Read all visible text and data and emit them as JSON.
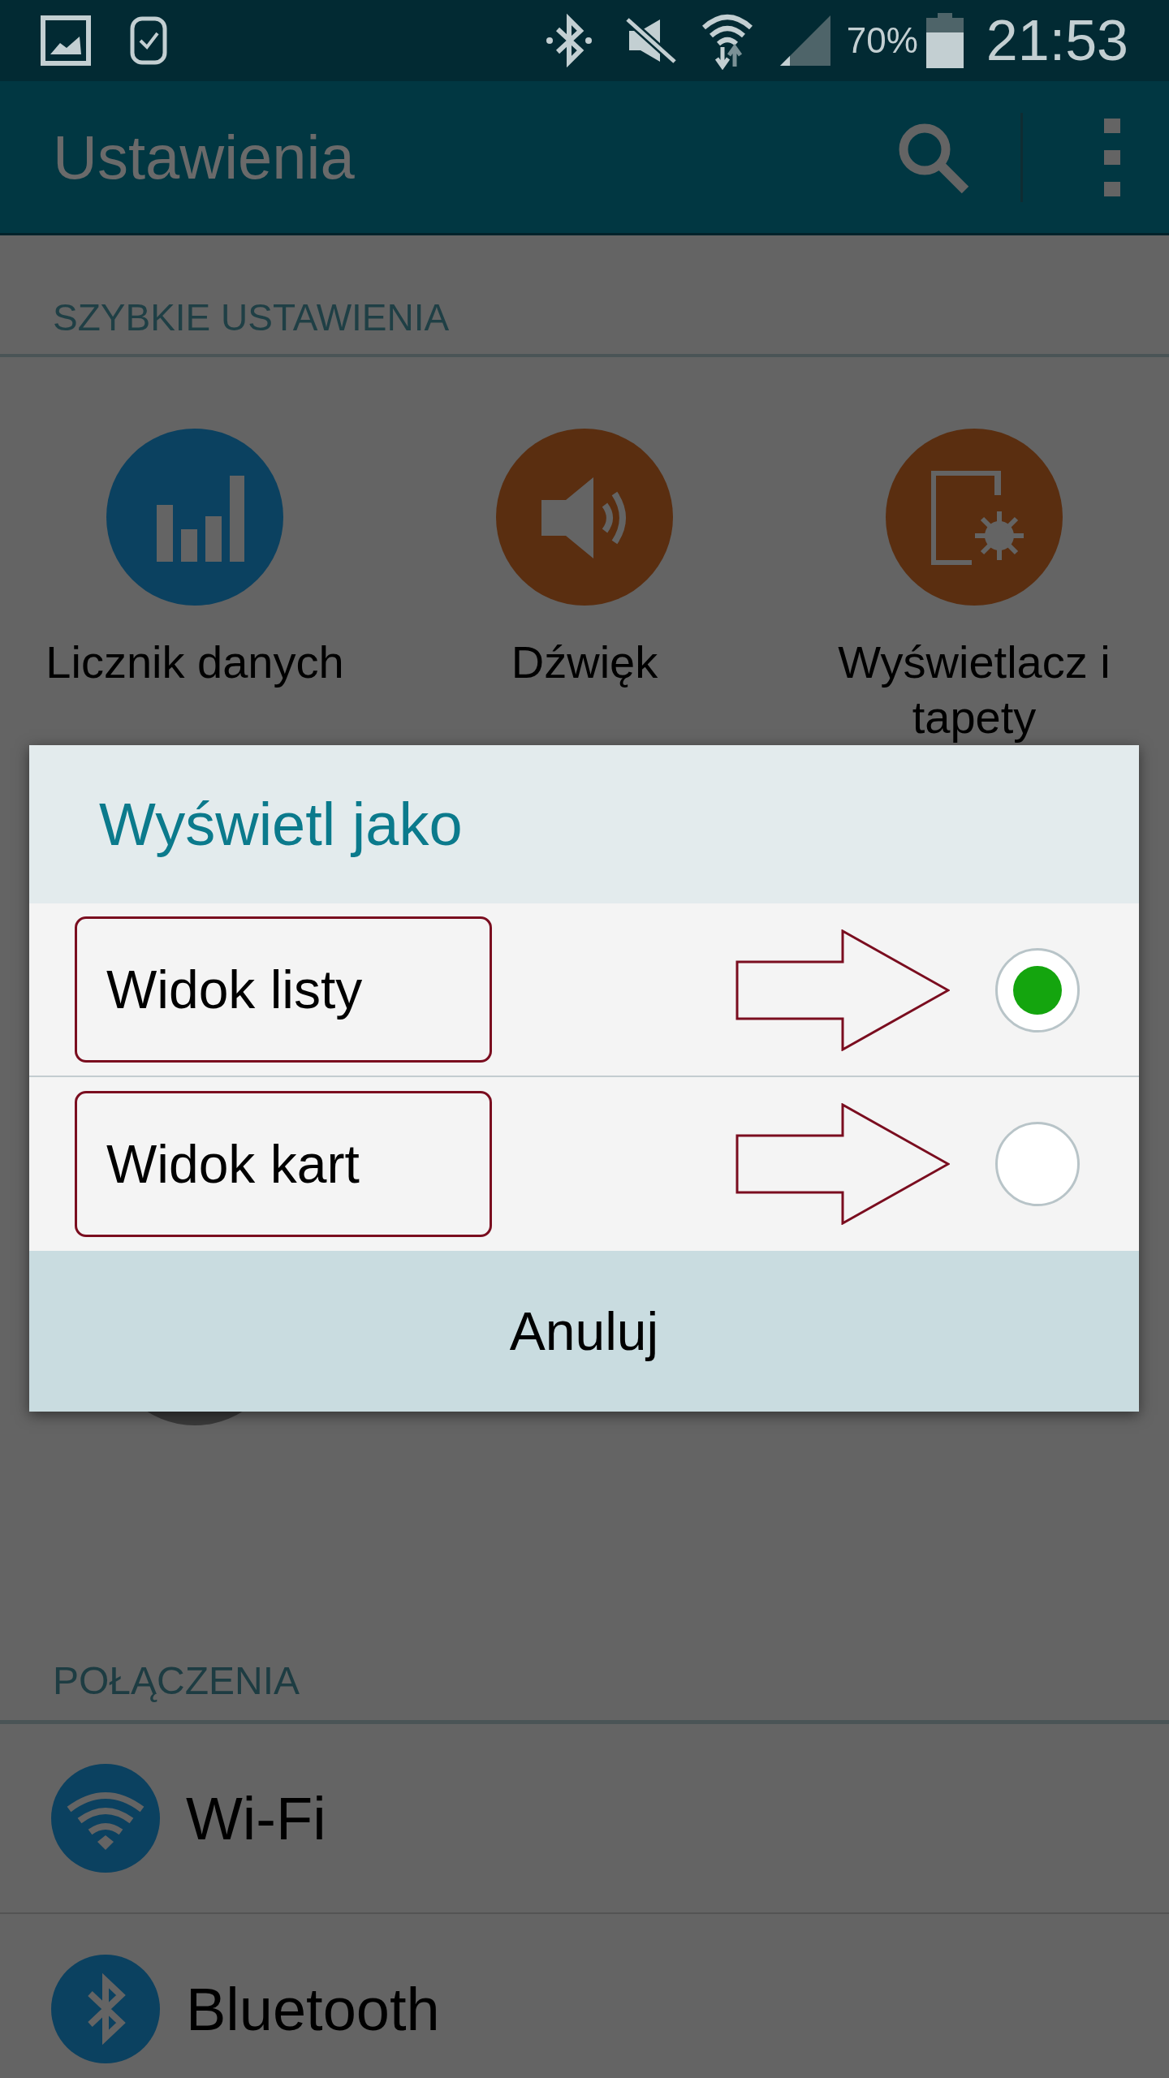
{
  "status_bar": {
    "battery": "70%",
    "time": "21:53"
  },
  "app_bar": {
    "title": "Ustawienia"
  },
  "quick_settings": {
    "header": "SZYBKIE USTAWIENIA",
    "tiles": [
      {
        "kind": "data",
        "label": "Licznik danych",
        "color": "#0b4160"
      },
      {
        "kind": "sound",
        "label": "Dźwięk",
        "color": "#5a2e10"
      },
      {
        "kind": "display",
        "label": "Wyświetlacz i tapety",
        "color": "#5a2e10"
      }
    ]
  },
  "dialog": {
    "title": "Wyświetl jako",
    "options": [
      {
        "label": "Widok listy",
        "selected": true
      },
      {
        "label": "Widok kart",
        "selected": false
      }
    ],
    "cancel": "Anuluj"
  },
  "connections": {
    "header": "POŁĄCZENIA",
    "items": [
      {
        "kind": "wifi",
        "label": "Wi-Fi"
      },
      {
        "kind": "bluetooth",
        "label": "Bluetooth"
      }
    ]
  }
}
